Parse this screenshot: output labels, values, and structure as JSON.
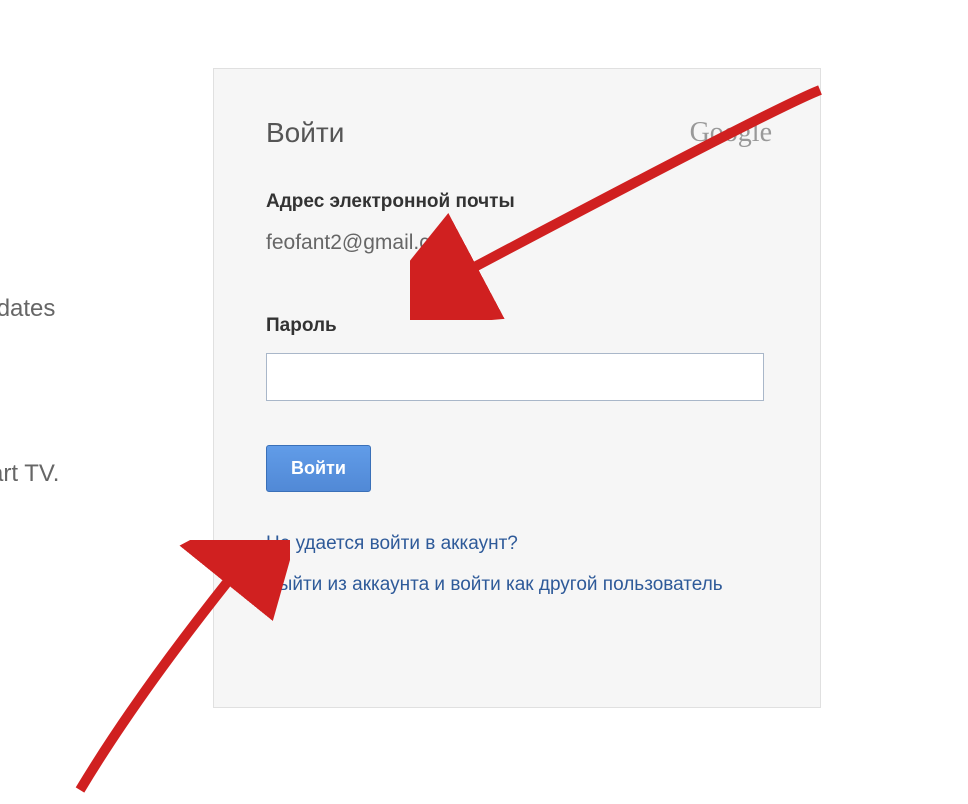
{
  "background": {
    "text1": "updates",
    "text2": "mart TV.",
    "text3": "."
  },
  "card": {
    "title": "Войти",
    "logo": "Google",
    "emailLabel": "Адрес электронной почты",
    "emailValue": "feofant2@gmail.com",
    "passwordLabel": "Пароль",
    "passwordValue": "",
    "signInButton": "Войти",
    "cantAccessLink": "Не удается войти в аккаунт?",
    "switchAccountLink": "Выйти из аккаунта и войти как другой пользователь"
  }
}
